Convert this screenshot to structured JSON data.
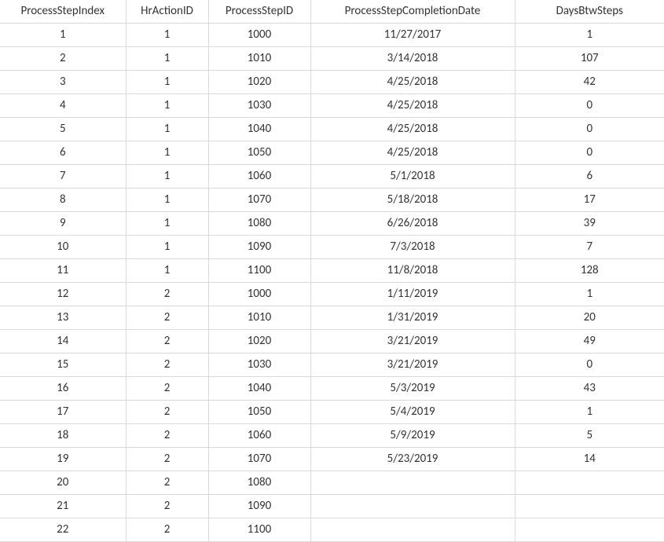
{
  "table": {
    "headers": {
      "processStepIndex": "ProcessStepIndex",
      "hrActionId": "HrActionID",
      "processStepId": "ProcessStepID",
      "processStepCompletionDate": "ProcessStepCompletionDate",
      "daysBtwSteps": "DaysBtwSteps"
    },
    "rows": [
      {
        "processStepIndex": "1",
        "hrActionId": "1",
        "processStepId": "1000",
        "processStepCompletionDate": "11/27/2017",
        "daysBtwSteps": "1"
      },
      {
        "processStepIndex": "2",
        "hrActionId": "1",
        "processStepId": "1010",
        "processStepCompletionDate": "3/14/2018",
        "daysBtwSteps": "107"
      },
      {
        "processStepIndex": "3",
        "hrActionId": "1",
        "processStepId": "1020",
        "processStepCompletionDate": "4/25/2018",
        "daysBtwSteps": "42"
      },
      {
        "processStepIndex": "4",
        "hrActionId": "1",
        "processStepId": "1030",
        "processStepCompletionDate": "4/25/2018",
        "daysBtwSteps": "0"
      },
      {
        "processStepIndex": "5",
        "hrActionId": "1",
        "processStepId": "1040",
        "processStepCompletionDate": "4/25/2018",
        "daysBtwSteps": "0"
      },
      {
        "processStepIndex": "6",
        "hrActionId": "1",
        "processStepId": "1050",
        "processStepCompletionDate": "4/25/2018",
        "daysBtwSteps": "0"
      },
      {
        "processStepIndex": "7",
        "hrActionId": "1",
        "processStepId": "1060",
        "processStepCompletionDate": "5/1/2018",
        "daysBtwSteps": "6"
      },
      {
        "processStepIndex": "8",
        "hrActionId": "1",
        "processStepId": "1070",
        "processStepCompletionDate": "5/18/2018",
        "daysBtwSteps": "17"
      },
      {
        "processStepIndex": "9",
        "hrActionId": "1",
        "processStepId": "1080",
        "processStepCompletionDate": "6/26/2018",
        "daysBtwSteps": "39"
      },
      {
        "processStepIndex": "10",
        "hrActionId": "1",
        "processStepId": "1090",
        "processStepCompletionDate": "7/3/2018",
        "daysBtwSteps": "7"
      },
      {
        "processStepIndex": "11",
        "hrActionId": "1",
        "processStepId": "1100",
        "processStepCompletionDate": "11/8/2018",
        "daysBtwSteps": "128"
      },
      {
        "processStepIndex": "12",
        "hrActionId": "2",
        "processStepId": "1000",
        "processStepCompletionDate": "1/11/2019",
        "daysBtwSteps": "1"
      },
      {
        "processStepIndex": "13",
        "hrActionId": "2",
        "processStepId": "1010",
        "processStepCompletionDate": "1/31/2019",
        "daysBtwSteps": "20"
      },
      {
        "processStepIndex": "14",
        "hrActionId": "2",
        "processStepId": "1020",
        "processStepCompletionDate": "3/21/2019",
        "daysBtwSteps": "49"
      },
      {
        "processStepIndex": "15",
        "hrActionId": "2",
        "processStepId": "1030",
        "processStepCompletionDate": "3/21/2019",
        "daysBtwSteps": "0"
      },
      {
        "processStepIndex": "16",
        "hrActionId": "2",
        "processStepId": "1040",
        "processStepCompletionDate": "5/3/2019",
        "daysBtwSteps": "43"
      },
      {
        "processStepIndex": "17",
        "hrActionId": "2",
        "processStepId": "1050",
        "processStepCompletionDate": "5/4/2019",
        "daysBtwSteps": "1"
      },
      {
        "processStepIndex": "18",
        "hrActionId": "2",
        "processStepId": "1060",
        "processStepCompletionDate": "5/9/2019",
        "daysBtwSteps": "5"
      },
      {
        "processStepIndex": "19",
        "hrActionId": "2",
        "processStepId": "1070",
        "processStepCompletionDate": "5/23/2019",
        "daysBtwSteps": "14"
      },
      {
        "processStepIndex": "20",
        "hrActionId": "2",
        "processStepId": "1080",
        "processStepCompletionDate": "",
        "daysBtwSteps": ""
      },
      {
        "processStepIndex": "21",
        "hrActionId": "2",
        "processStepId": "1090",
        "processStepCompletionDate": "",
        "daysBtwSteps": ""
      },
      {
        "processStepIndex": "22",
        "hrActionId": "2",
        "processStepId": "1100",
        "processStepCompletionDate": "",
        "daysBtwSteps": ""
      }
    ]
  }
}
